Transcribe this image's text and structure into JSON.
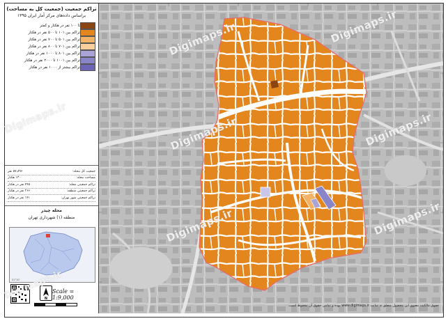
{
  "panel": {
    "title_line1": "تراکم جمعیت (جمعیت کل به مساحت)",
    "title_line2": "براساس داده‌های مرکز آمار ایران ۱۳۹۵",
    "legend": [
      {
        "label": "تا ۱۰۰ نفر در هکتار و کمتر",
        "color": "#8b4513"
      },
      {
        "label": "تراکم بین ۱۰۱ تا ۵۰۰ نفر در هکتار",
        "color": "#e3861e"
      },
      {
        "label": "تراکم بین ۵۰۱ تا ۷۰۰ نفر در هکتار",
        "color": "#f2b366"
      },
      {
        "label": "تراکم بین ۷۰۱ تا ۸۰۰ نفر در هکتار",
        "color": "#f6cf9c"
      },
      {
        "label": "تراکم بین ۸۰۱ تا ۱۰۰۰ نفر در هکتار",
        "color": "#a9a3d6"
      },
      {
        "label": "تراکم بین ۱۰۰۱ تا ۲۰۰۰ نفر در هکتار",
        "color": "#8a84c8"
      },
      {
        "label": "تراکم بیشتر از ۱۰۰۰ نفر در هکتار",
        "color": "#6c66b4"
      }
    ],
    "stats": [
      {
        "label": "جمعیت کل محله:",
        "value": "۵۷,۸۹۶ نفر"
      },
      {
        "label": "مساحت محله:",
        "value": "۱۳۰ هکتار"
      },
      {
        "label": "تراکم جمعیتی محله:",
        "value": "۴۴۵ نفر در هکتار"
      },
      {
        "label": "تراکم جمعیتی منطقه:",
        "value": "۲۶۶ نفر در هکتار"
      },
      {
        "label": "تراکم جمعیتی شهر تهران:",
        "value": "۱۴۱ نفر در هکتار"
      }
    ],
    "region_line1": "محله چیذر",
    "region_line2": "منطقه (۱) شهرداری تهران",
    "scale": "Scale = 1:9,000"
  },
  "map": {
    "watermark": "Digimaps.ir",
    "copyright": "حقوق مالکیت معنوی این محصول متعلق به سایت www.digimaps.ir بوده و تمامی حقوق آن محفوظ است.",
    "colors": {
      "background": "#bfbfbf",
      "district_fill": "#e3861e",
      "district_border": "#e86a6a",
      "roads": "#ffffff",
      "low_density": "#8b4513",
      "high_density_a": "#f2b366",
      "high_density_b": "#8a84c8",
      "high_density_c": "#a9a3d6"
    }
  }
}
